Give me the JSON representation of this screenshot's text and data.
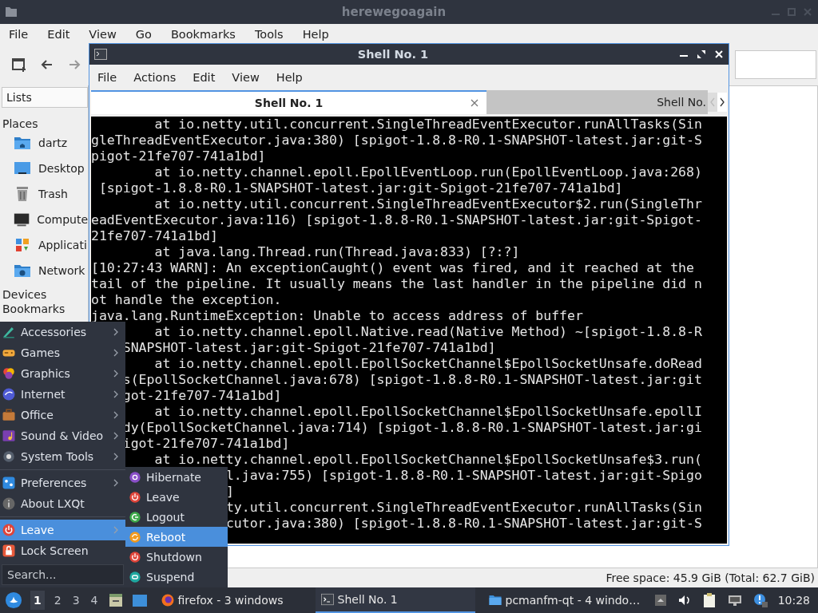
{
  "file_manager": {
    "title": "herewegoagain",
    "menu": [
      "File",
      "Edit",
      "View",
      "Go",
      "Bookmarks",
      "Tools",
      "Help"
    ],
    "side_panel": {
      "dropdown": "Lists",
      "places_label": "Places",
      "places": [
        {
          "label": "dartz"
        },
        {
          "label": "Desktop"
        },
        {
          "label": "Trash"
        },
        {
          "label": "Compute"
        },
        {
          "label": "Applicati"
        },
        {
          "label": "Network"
        }
      ],
      "devices_label": "Devices",
      "bookmarks_label": "Bookmarks"
    },
    "status": "Free space: 45.9 GiB (Total: 62.7 GiB)"
  },
  "terminal": {
    "title": "Shell No. 1",
    "menu": [
      "File",
      "Actions",
      "Edit",
      "View",
      "Help"
    ],
    "tabs": [
      {
        "label": "Shell No. 1",
        "selected": true
      },
      {
        "label": "Shell No.",
        "selected": false
      }
    ],
    "lines": [
      "        at io.netty.util.concurrent.SingleThreadEventExecutor.runAllTasks(Sin",
      "gleThreadEventExecutor.java:380) [spigot-1.8.8-R0.1-SNAPSHOT-latest.jar:git-S",
      "pigot-21fe707-741a1bd]",
      "        at io.netty.channel.epoll.EpollEventLoop.run(EpollEventLoop.java:268)",
      " [spigot-1.8.8-R0.1-SNAPSHOT-latest.jar:git-Spigot-21fe707-741a1bd]",
      "        at io.netty.util.concurrent.SingleThreadEventExecutor$2.run(SingleThr",
      "eadEventExecutor.java:116) [spigot-1.8.8-R0.1-SNAPSHOT-latest.jar:git-Spigot-",
      "21fe707-741a1bd]",
      "        at java.lang.Thread.run(Thread.java:833) [?:?]",
      "[10:27:43 WARN]: An exceptionCaught() event was fired, and it reached at the",
      "tail of the pipeline. It usually means the last handler in the pipeline did n",
      "ot handle the exception.",
      "java.lang.RuntimeException: Unable to access address of buffer",
      "        at io.netty.channel.epoll.Native.read(Native Method) ~[spigot-1.8.8-R",
      "    SNAPSHOT-latest.jar:git-Spigot-21fe707-741a1bd]",
      "        at io.netty.channel.epoll.EpollSocketChannel$EpollSocketUnsafe.doRead",
      "    s(EpollSocketChannel.java:678) [spigot-1.8.8-R0.1-SNAPSHOT-latest.jar:git",
      "    got-21fe707-741a1bd]",
      "        at io.netty.channel.epoll.EpollSocketChannel$EpollSocketUnsafe.epollI",
      "    dy(EpollSocketChannel.java:714) [spigot-1.8.8-R0.1-SNAPSHOT-latest.jar:gi",
      "    igot-21fe707-741a1bd]",
      "        at io.netty.channel.epoll.EpollSocketChannel$EpollSocketUnsafe$3.run(",
      "                 l.java:755) [spigot-1.8.8-R0.1-SNAPSHOT-latest.jar:git-Spigo",
      "                 ]",
      "                 ty.util.concurrent.SingleThreadEventExecutor.runAllTasks(Sin",
      "                 cutor.java:380) [spigot-1.8.8-R0.1-SNAPSHOT-latest.jar:git-S"
    ]
  },
  "start_menu": {
    "groups": [
      {
        "items": [
          {
            "label": "Accessories",
            "submenu": true,
            "selected": false
          },
          {
            "label": "Games",
            "submenu": true,
            "selected": false
          },
          {
            "label": "Graphics",
            "submenu": true,
            "selected": false
          },
          {
            "label": "Internet",
            "submenu": true,
            "selected": false
          },
          {
            "label": "Office",
            "submenu": true,
            "selected": false
          },
          {
            "label": "Sound & Video",
            "submenu": true,
            "selected": false
          },
          {
            "label": "System Tools",
            "submenu": true,
            "selected": false
          }
        ]
      },
      {
        "items": [
          {
            "label": "Preferences",
            "submenu": true,
            "selected": false
          },
          {
            "label": "About LXQt",
            "submenu": false,
            "selected": false
          }
        ]
      },
      {
        "items": [
          {
            "label": "Leave",
            "submenu": true,
            "selected": true
          },
          {
            "label": "Lock Screen",
            "submenu": false,
            "selected": false
          }
        ]
      }
    ],
    "search_placeholder": "Search...",
    "submenu": [
      {
        "label": "Hibernate",
        "selected": false
      },
      {
        "label": "Leave",
        "selected": false
      },
      {
        "label": "Logout",
        "selected": false
      },
      {
        "label": "Reboot",
        "selected": true
      },
      {
        "label": "Shutdown",
        "selected": false
      },
      {
        "label": "Suspend",
        "selected": false
      }
    ]
  },
  "taskbar": {
    "desktops": [
      {
        "label": "1",
        "selected": true
      },
      {
        "label": "2",
        "selected": false
      },
      {
        "label": "3",
        "selected": false
      },
      {
        "label": "4",
        "selected": false
      }
    ],
    "tasks": [
      {
        "label": "firefox - 3 windows",
        "selected": false
      },
      {
        "label": "Shell No. 1",
        "selected": true
      },
      {
        "label": "pcmanfm-qt - 4 windo…",
        "selected": false
      }
    ],
    "clock": "10:28"
  }
}
